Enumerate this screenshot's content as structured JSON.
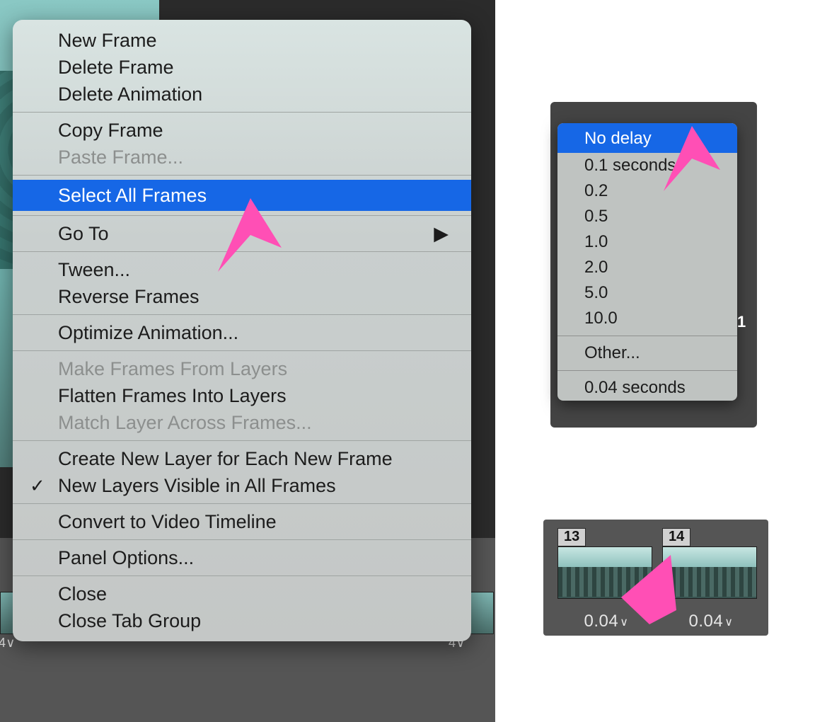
{
  "main_menu": {
    "new_frame": "New Frame",
    "delete_frame": "Delete Frame",
    "delete_animation": "Delete Animation",
    "copy_frame": "Copy Frame",
    "paste_frame": "Paste Frame...",
    "select_all_frames": "Select All Frames",
    "go_to": "Go To",
    "tween": "Tween...",
    "reverse_frames": "Reverse Frames",
    "optimize_animation": "Optimize Animation...",
    "make_frames_from_layers": "Make Frames From Layers",
    "flatten_frames_into_layers": "Flatten Frames Into Layers",
    "match_layer_across_frames": "Match Layer Across Frames...",
    "create_new_layer": "Create New Layer for Each New Frame",
    "new_layers_visible": "New Layers Visible in All Frames",
    "convert_to_video_timeline": "Convert to Video Timeline",
    "panel_options": "Panel Options...",
    "close": "Close",
    "close_tab_group": "Close Tab Group"
  },
  "delay_menu": {
    "no_delay": "No delay",
    "d01": "0.1 seconds",
    "d02": "0.2",
    "d05": "0.5",
    "d10": "1.0",
    "d20": "2.0",
    "d50": "5.0",
    "d100": "10.0",
    "other": "Other...",
    "current": "0.04 seconds"
  },
  "timeline": {
    "left_cell_label": "4∨",
    "right_cell_label": "4∨"
  },
  "frames": {
    "f13": {
      "label": "13",
      "delay": "0.04"
    },
    "f14": {
      "label": "14",
      "delay": "0.04"
    },
    "peek": "1"
  },
  "colors": {
    "highlight": "#1667e6",
    "cursor": "#ff4fb5"
  }
}
